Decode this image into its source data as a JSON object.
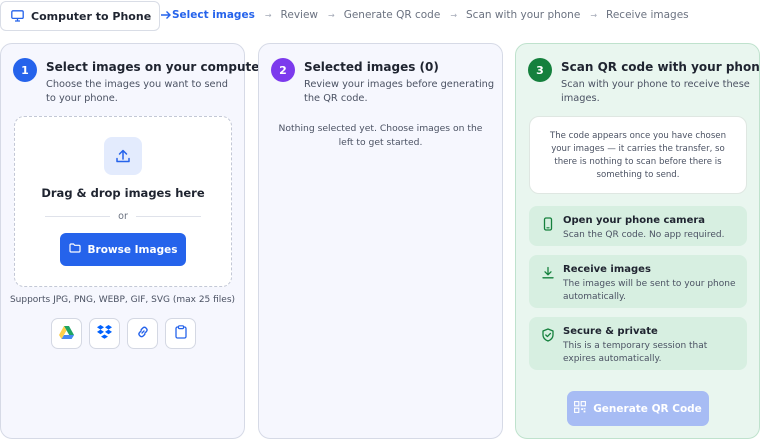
{
  "top_bar": {
    "mode_button": {
      "label": "Computer to Phone",
      "icon": "monitor-icon",
      "arrow_icon": "arrow-right-icon"
    },
    "steps": [
      "Select images",
      "Review",
      "Generate QR code",
      "Scan with your phone",
      "Receive images"
    ],
    "active_step": "Select images",
    "separator": "→"
  },
  "panel1": {
    "number": "1",
    "title": "Select images on your computer",
    "subtitle": "Choose the images you want to send to your phone.",
    "dropzone": {
      "icon": "upload-icon",
      "title": "Drag & drop images here",
      "or": "or",
      "browse_label": "Browse Images",
      "browse_icon": "folder-icon"
    },
    "supports": "Supports JPG, PNG, WEBP, GIF, SVG (max 25 files)",
    "sources": [
      "google-drive-icon",
      "dropbox-icon",
      "link-icon",
      "clipboard-icon"
    ]
  },
  "panel2": {
    "number": "2",
    "title": "Selected images (0)",
    "subtitle": "Review your images before generating the QR code.",
    "empty_message": "Nothing selected yet. Choose images on the left to get started."
  },
  "panel3": {
    "number": "3",
    "title": "Scan QR code with your phone",
    "subtitle": "Scan with your phone to receive these images.",
    "qr_placeholder": "The code appears once you have chosen your images — it carries the transfer, so there is nothing to scan before there is something to send.",
    "info": [
      {
        "icon": "phone-icon",
        "title": "Open your phone camera",
        "desc": "Scan the QR code. No app required."
      },
      {
        "icon": "download-icon",
        "title": "Receive images",
        "desc": "The images will be sent to your phone automatically."
      },
      {
        "icon": "shield-check-icon",
        "title": "Secure & private",
        "desc": "This is a temporary session that expires automatically."
      }
    ],
    "generate_label": "Generate QR Code",
    "generate_icon": "qr-icon",
    "generate_enabled": false
  },
  "colors": {
    "accent": "#2563eb",
    "step1": "#2563eb",
    "step2": "#7c3aed",
    "step3": "#15803d",
    "panel3_bg": "#e9f6ef",
    "info_bg": "#d7efe1",
    "disabled_button": "#a7bcf4"
  }
}
